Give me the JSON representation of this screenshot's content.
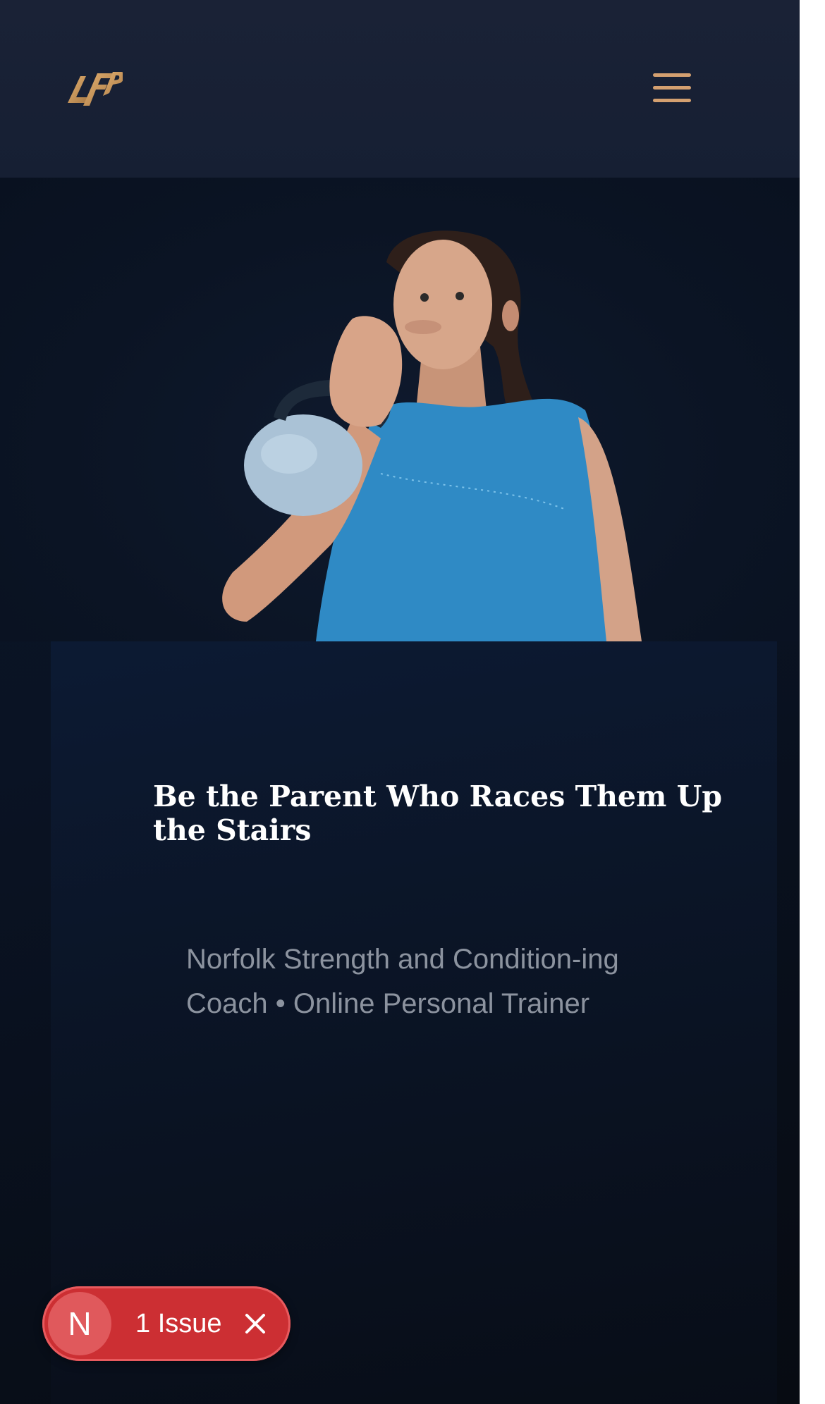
{
  "header": {
    "logo_alt": "LFP",
    "menu_icon": "hamburger-menu-icon"
  },
  "hero": {
    "image_description_icon": "athlete-photo",
    "title": "Be the Parent Who Races Them Up the Stairs",
    "subtitle": "Norfolk Strength and Condition-ing Coach • Online Personal Trainer"
  },
  "dev_overlay": {
    "avatar_letter": "N",
    "issue_label": "1 Issue",
    "close_icon": "close-icon"
  },
  "colors": {
    "accent": "#d4a070",
    "issue_red": "#cc2f33",
    "background": "#0b1424"
  }
}
